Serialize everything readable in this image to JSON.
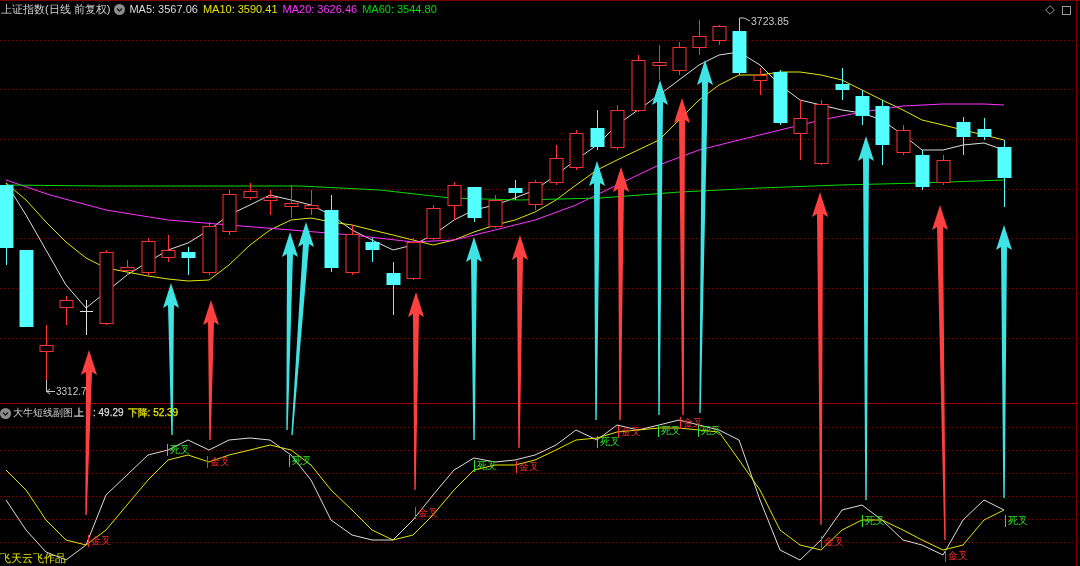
{
  "header": {
    "title": "上证指数(日线 前复权)",
    "moving_averages": [
      {
        "label": "MA5: 3567.06",
        "color": "#dcdcdc"
      },
      {
        "label": "MA10: 3590.41",
        "color": "#e6e600"
      },
      {
        "label": "MA20: 3626.46",
        "color": "#ff33ff"
      },
      {
        "label": "MA60: 3544.80",
        "color": "#00dd00"
      }
    ]
  },
  "price_chart": {
    "high_marker": "3723.85",
    "low_marker": "3312.7"
  },
  "indicator_panel": {
    "title": "大牛短线副图",
    "readings": [
      {
        "texts": [
          "上",
          ": 49.29"
        ],
        "color": "#dcdcdc"
      },
      {
        "texts": [
          "下降: 52.39"
        ],
        "color": "#e6e600"
      }
    ],
    "signals": [
      {
        "kind": "golden",
        "text": "金叉"
      },
      {
        "kind": "dead",
        "text": "死叉"
      },
      {
        "kind": "golden",
        "text": "金叉"
      },
      {
        "kind": "dead",
        "text": "死叉"
      },
      {
        "kind": "golden",
        "text": "金叉"
      },
      {
        "kind": "dead",
        "text": "死叉"
      },
      {
        "kind": "golden",
        "text": "金叉"
      },
      {
        "kind": "dead",
        "text": "死叉"
      },
      {
        "kind": "golden",
        "text": "金叉"
      },
      {
        "kind": "dead",
        "text": "死叉"
      },
      {
        "kind": "golden",
        "text": "金叉"
      },
      {
        "kind": "dead",
        "text": "死叉"
      },
      {
        "kind": "golden",
        "text": "金叉"
      },
      {
        "kind": "dead",
        "text": "死叉"
      },
      {
        "kind": "golden",
        "text": "金叉"
      },
      {
        "kind": "dead",
        "text": "死叉"
      }
    ],
    "credit": "飞天云飞作品"
  }
}
